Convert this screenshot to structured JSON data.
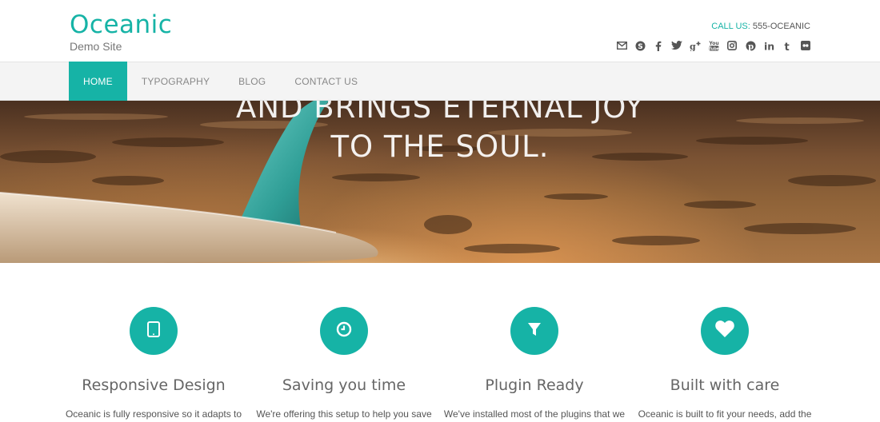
{
  "site": {
    "title": "Oceanic",
    "subtitle": "Demo Site",
    "call_label": "CALL US:",
    "call_number": " 555-OCEANIC"
  },
  "social": [
    "email-icon",
    "skype-icon",
    "facebook-icon",
    "twitter-icon",
    "google-plus-icon",
    "youtube-icon",
    "instagram-icon",
    "pinterest-icon",
    "linkedin-icon",
    "tumblr-icon",
    "flickr-icon"
  ],
  "nav": {
    "items": [
      {
        "label": "HOME",
        "active": true
      },
      {
        "label": "TYPOGRAPHY",
        "active": false
      },
      {
        "label": "BLOG",
        "active": false
      },
      {
        "label": "CONTACT US",
        "active": false
      }
    ]
  },
  "hero": {
    "line1": "AND BRINGS ETERNAL JOY",
    "line2": "TO THE SOUL."
  },
  "features": [
    {
      "icon": "tablet-icon",
      "title": "Responsive Design",
      "text": "Oceanic is fully responsive so it adapts to"
    },
    {
      "icon": "clock-icon",
      "title": "Saving you time",
      "text": "We're offering this setup to help you save"
    },
    {
      "icon": "filter-icon",
      "title": "Plugin Ready",
      "text": "We've installed most of the plugins that we"
    },
    {
      "icon": "heart-icon",
      "title": "Built with care",
      "text": "Oceanic is built to fit your needs, add the"
    }
  ],
  "colors": {
    "accent": "#16b3a6",
    "nav_bg": "#f4f4f4",
    "text": "#666666"
  }
}
